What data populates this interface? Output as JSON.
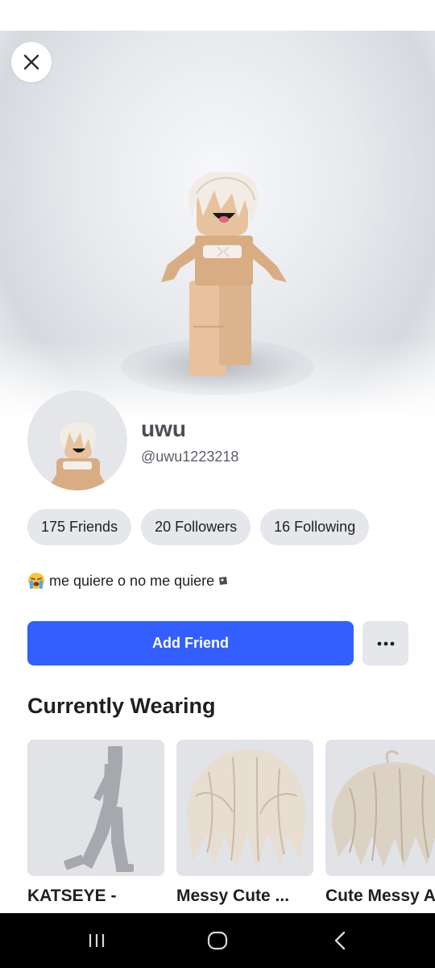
{
  "close_icon": "close-icon",
  "profile": {
    "display_name": "uwu",
    "username": "@uwu1223218"
  },
  "stats": [
    {
      "count": "175",
      "label": "Friends"
    },
    {
      "count": "20",
      "label": "Followers"
    },
    {
      "count": "16",
      "label": "Following"
    }
  ],
  "bio": {
    "emoji_icon": "crying-face-icon",
    "text": "me quiere o no me quiere",
    "trailing_icon": "label-tag-icon"
  },
  "actions": {
    "add_friend_label": "Add Friend",
    "more_icon": "more-options-icon"
  },
  "currently_wearing": {
    "title": "Currently Wearing",
    "items": [
      {
        "name": "KATSEYE -",
        "thumb": "emote-pose"
      },
      {
        "name": "Messy Cute ...",
        "thumb": "hair"
      },
      {
        "name": "Cute Messy A",
        "thumb": "hair"
      }
    ]
  },
  "nav": {
    "recents_icon": "recent-apps-icon",
    "home_icon": "home-icon",
    "back_icon": "back-icon"
  },
  "colors": {
    "accent": "#335fff",
    "pill_bg": "#e6e7eb",
    "text": "#1e1f23"
  }
}
